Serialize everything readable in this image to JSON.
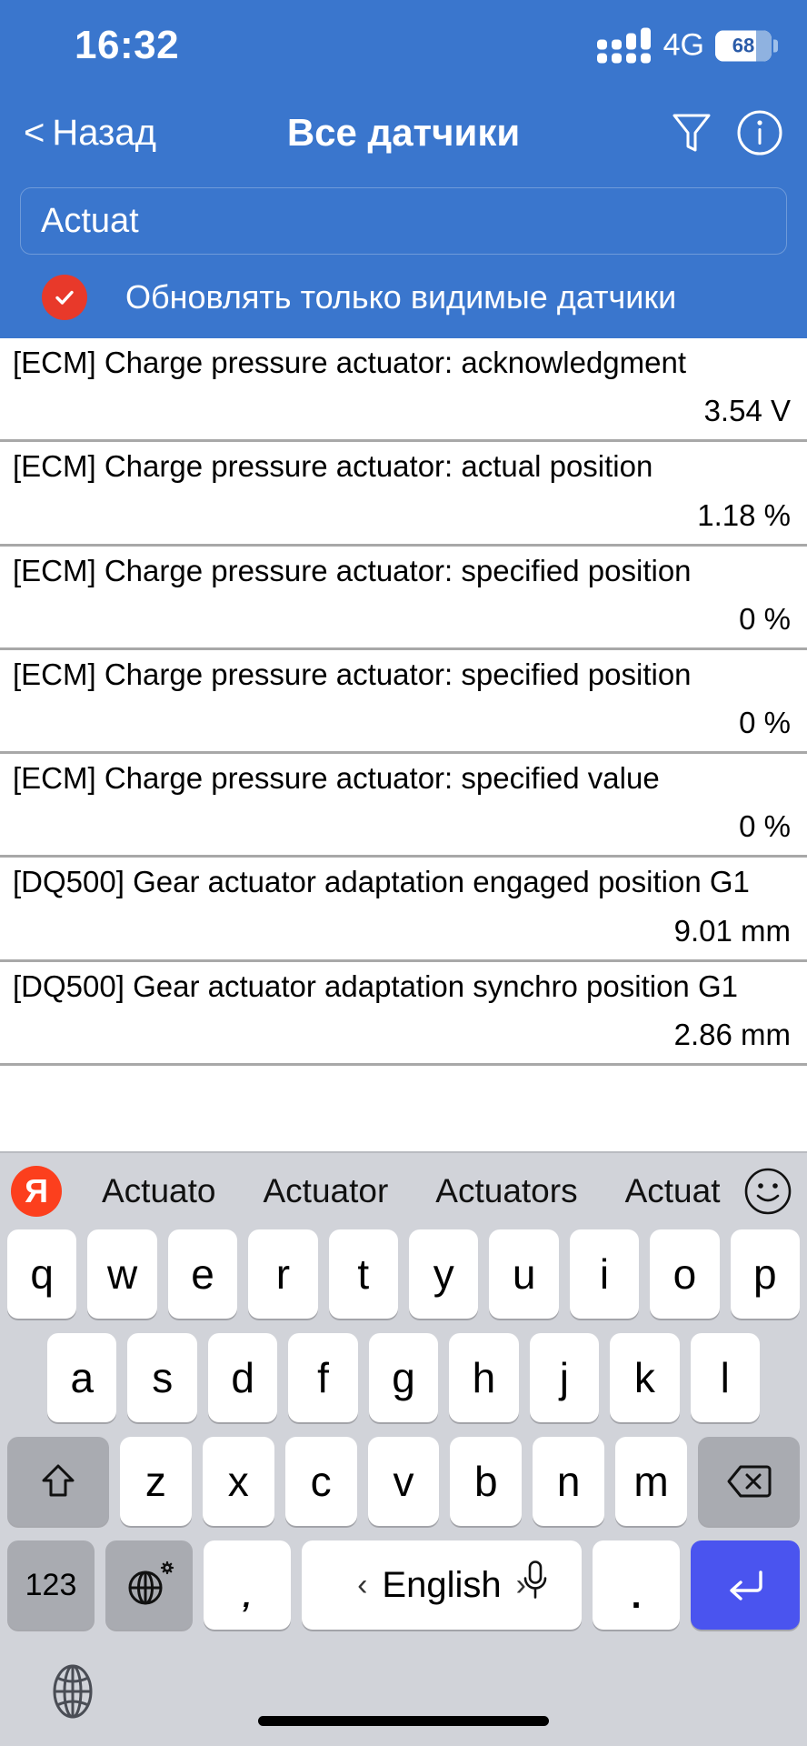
{
  "status_bar": {
    "time": "16:32",
    "network": "4G",
    "battery_percent": "68"
  },
  "nav": {
    "back_label": "Назад",
    "title": "Все датчики",
    "filter_icon": "funnel-icon",
    "info_icon": "info-circle-icon"
  },
  "search": {
    "value": "Actuat",
    "placeholder": ""
  },
  "options": {
    "visible_only_label": "Обновлять только видимые датчики",
    "visible_only_checked": true,
    "check_color": "#e8392a"
  },
  "sensors": [
    {
      "name": "[ECM] Charge pressure actuator: acknowledgment",
      "value": "3.54 V"
    },
    {
      "name": "[ECM] Charge pressure actuator: actual position",
      "value": "1.18 %"
    },
    {
      "name": "[ECM] Charge pressure actuator: specified position",
      "value": "0 %"
    },
    {
      "name": "[ECM] Charge pressure actuator: specified position",
      "value": "0 %"
    },
    {
      "name": "[ECM] Charge pressure actuator: specified value",
      "value": "0 %"
    },
    {
      "name": "[DQ500] Gear actuator adaptation engaged position G1",
      "value": "9.01 mm"
    },
    {
      "name": "[DQ500] Gear actuator adaptation synchro position G1",
      "value": "2.86 mm"
    }
  ],
  "keyboard": {
    "brand_logo": "Я",
    "suggestions": [
      "Actuato",
      "Actuator",
      "Actuators",
      "Actuat"
    ],
    "emoji_icon": "smiley-icon",
    "row1": [
      "q",
      "w",
      "e",
      "r",
      "t",
      "y",
      "u",
      "i",
      "o",
      "p"
    ],
    "row2": [
      "a",
      "s",
      "d",
      "f",
      "g",
      "h",
      "j",
      "k",
      "l"
    ],
    "row3": [
      "z",
      "x",
      "c",
      "v",
      "b",
      "n",
      "m"
    ],
    "shift_icon": "shift-arrow-icon",
    "backspace_icon": "backspace-icon",
    "numeric_label": "123",
    "globe_icon": "globe-gear-icon",
    "comma_label": ",",
    "space_label": "English",
    "space_prev_icon": "‹",
    "space_next_icon": "›",
    "mic_icon": "microphone-icon",
    "period_label": ".",
    "return_icon": "return-enter-icon",
    "return_color": "#4a54ef",
    "bottom_globe_icon": "globe-icon"
  },
  "theme": {
    "header_blue": "#3a76cd",
    "keyboard_grey": "#d1d3d9"
  }
}
